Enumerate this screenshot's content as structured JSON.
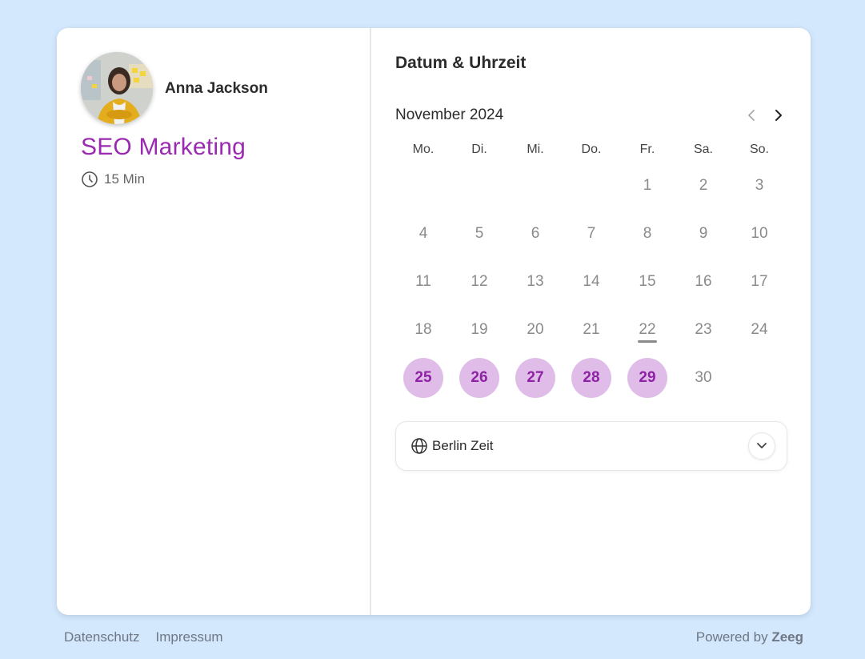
{
  "host": {
    "name": "Anna Jackson",
    "avatar_icon": "person-photo"
  },
  "event": {
    "title": "SEO Marketing",
    "duration": "15 Min",
    "duration_icon": "clock-icon"
  },
  "scheduler": {
    "title": "Datum & Uhrzeit",
    "month": "November 2024",
    "weekdays": [
      "Mo.",
      "Di.",
      "Mi.",
      "Do.",
      "Fr.",
      "Sa.",
      "So."
    ],
    "leading_blanks": 4,
    "days": [
      {
        "d": "1"
      },
      {
        "d": "2"
      },
      {
        "d": "3"
      },
      {
        "d": "4"
      },
      {
        "d": "5"
      },
      {
        "d": "6"
      },
      {
        "d": "7"
      },
      {
        "d": "8"
      },
      {
        "d": "9"
      },
      {
        "d": "10"
      },
      {
        "d": "11"
      },
      {
        "d": "12"
      },
      {
        "d": "13"
      },
      {
        "d": "14"
      },
      {
        "d": "15"
      },
      {
        "d": "16"
      },
      {
        "d": "17"
      },
      {
        "d": "18"
      },
      {
        "d": "19"
      },
      {
        "d": "20"
      },
      {
        "d": "21"
      },
      {
        "d": "22",
        "today": true
      },
      {
        "d": "23"
      },
      {
        "d": "24"
      },
      {
        "d": "25",
        "available": true
      },
      {
        "d": "26",
        "available": true
      },
      {
        "d": "27",
        "available": true
      },
      {
        "d": "28",
        "available": true
      },
      {
        "d": "29",
        "available": true
      },
      {
        "d": "30"
      }
    ],
    "timezone": {
      "label": "Berlin Zeit",
      "icon": "globe-icon"
    }
  },
  "footer": {
    "privacy": "Datenschutz",
    "imprint": "Impressum",
    "powered_by": "Powered by",
    "brand": "Zeeg"
  },
  "colors": {
    "accent": "#9a2bb0",
    "available_bg": "#e0bde8",
    "brand": "#f07a1a",
    "background": "#d3e7fd"
  }
}
